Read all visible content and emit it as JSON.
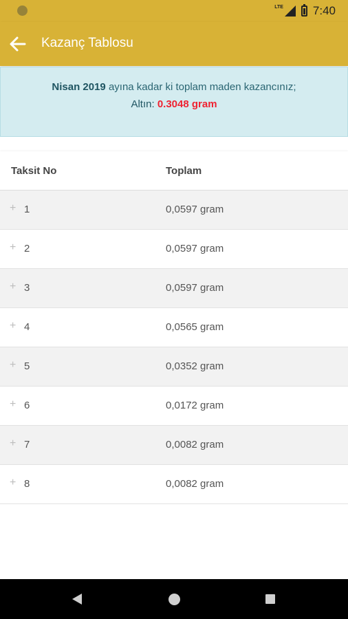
{
  "status_bar": {
    "network": "LTE",
    "time": "7:40",
    "icons": [
      "notification-dot-icon",
      "signal-icon",
      "battery-icon"
    ]
  },
  "app_bar": {
    "back_icon": "arrow-back-icon",
    "title": "Kazanç Tablosu"
  },
  "info": {
    "month": "Nisan 2019",
    "line1_rest": " ayına kadar ki toplam maden kazancınız;",
    "gold_label": "Altın: ",
    "gold_value": "0.3048 gram"
  },
  "table": {
    "headers": {
      "no": "Taksit No",
      "total": "Toplam"
    },
    "rows": [
      {
        "expand": "+",
        "no": "1",
        "total": "0,0597 gram"
      },
      {
        "expand": "+",
        "no": "2",
        "total": "0,0597 gram"
      },
      {
        "expand": "+",
        "no": "3",
        "total": "0,0597 gram"
      },
      {
        "expand": "+",
        "no": "4",
        "total": "0,0565 gram"
      },
      {
        "expand": "+",
        "no": "5",
        "total": "0,0352 gram"
      },
      {
        "expand": "+",
        "no": "6",
        "total": "0,0172 gram"
      },
      {
        "expand": "+",
        "no": "7",
        "total": "0,0082 gram"
      },
      {
        "expand": "+",
        "no": "8",
        "total": "0,0082 gram"
      }
    ]
  },
  "nav_bar": {
    "icons": [
      "nav-back-icon",
      "nav-home-icon",
      "nav-recents-icon"
    ]
  },
  "colors": {
    "app_bar": "#d8b236",
    "info_background": "#d4ecf0",
    "gold_value": "#ef2231",
    "row_alt": "#f2f2f2"
  }
}
